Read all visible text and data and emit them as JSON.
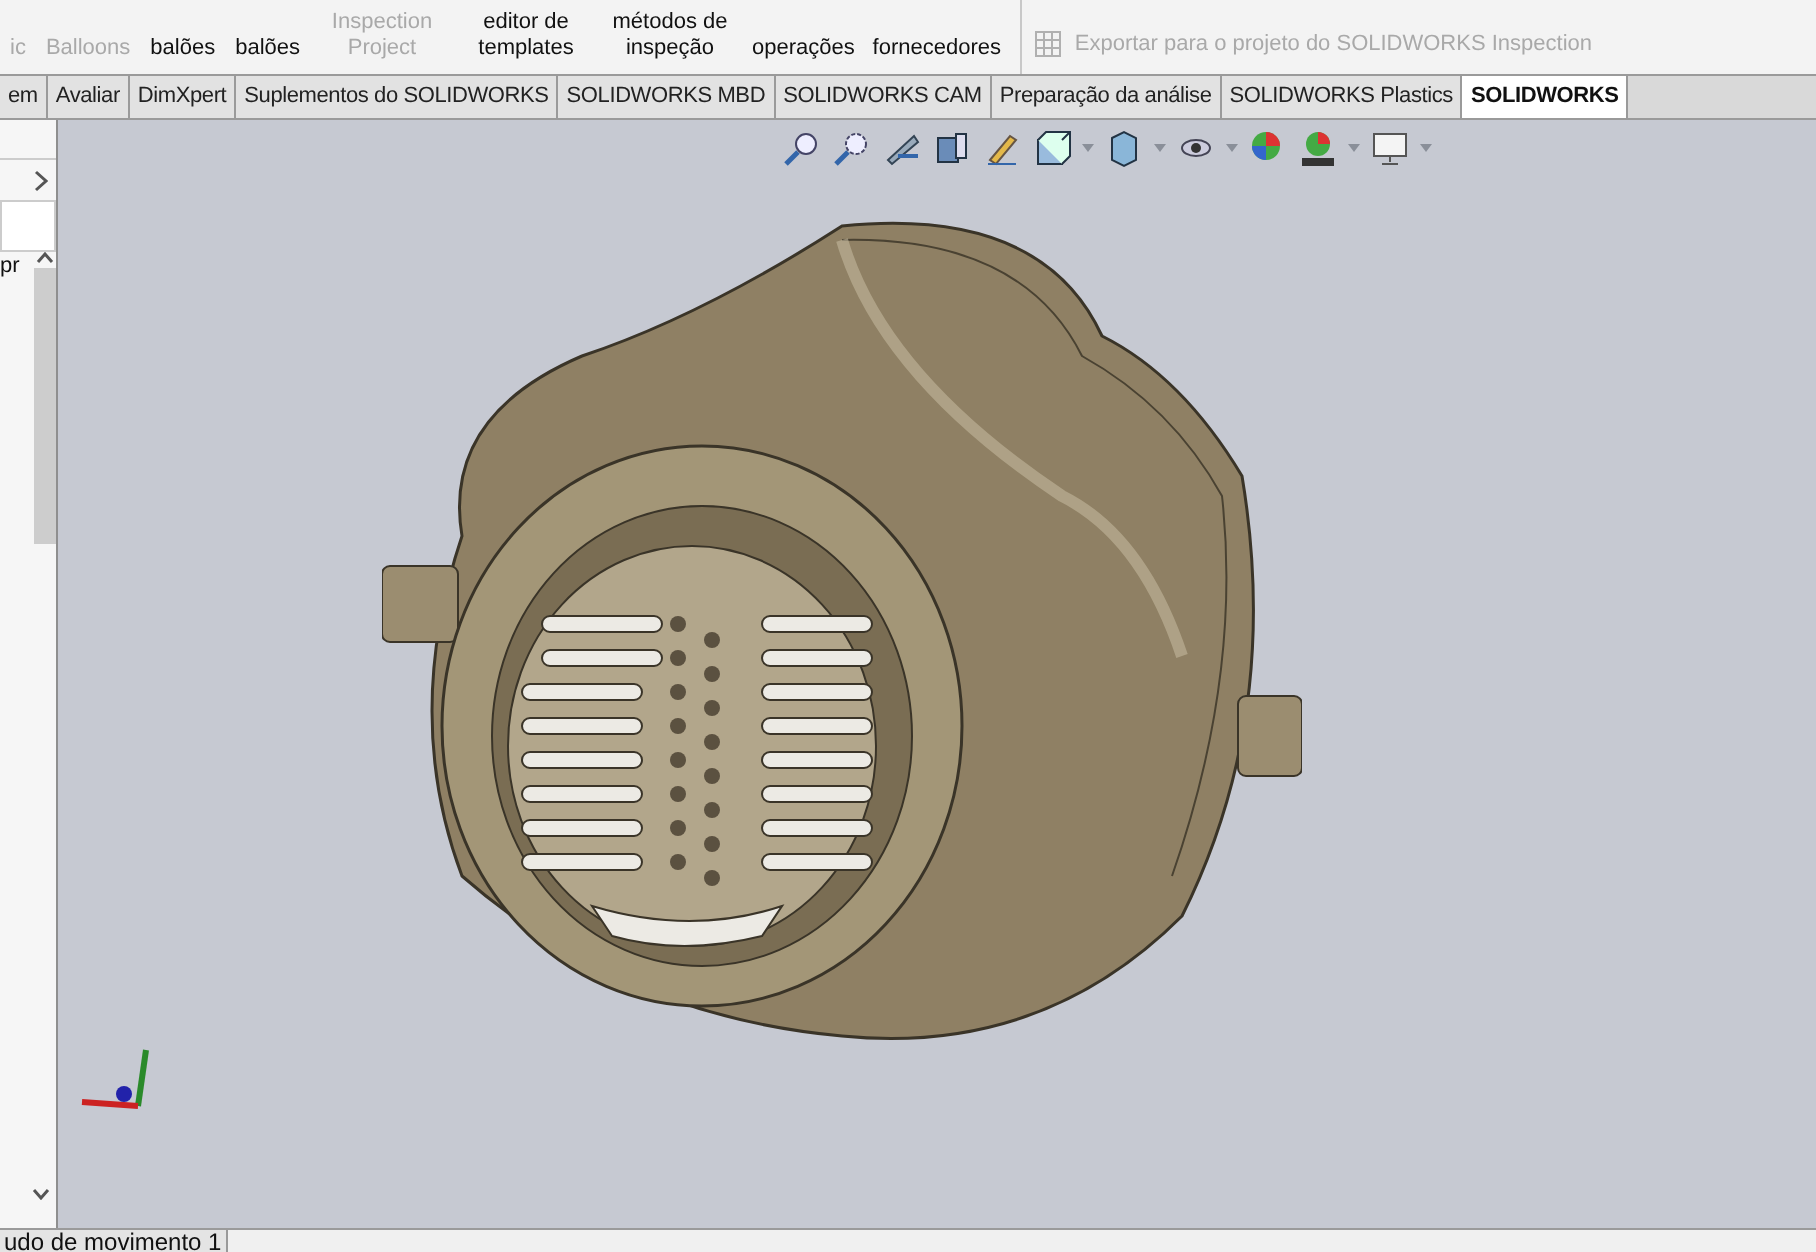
{
  "ribbon": {
    "items": [
      {
        "label": "ic",
        "disabled": true
      },
      {
        "label": "Balloons",
        "disabled": true
      },
      {
        "label": "balões",
        "disabled": false
      },
      {
        "label": "balões",
        "disabled": false
      },
      {
        "label": "Inspection Project",
        "disabled": true
      },
      {
        "label": "editor de templates",
        "disabled": false
      },
      {
        "label": "métodos de inspeção",
        "disabled": false
      },
      {
        "label": "operações",
        "disabled": false
      },
      {
        "label": "fornecedores",
        "disabled": false
      }
    ],
    "export_action": {
      "label": "Exportar para o projeto do SOLIDWORKS Inspection",
      "disabled": true
    }
  },
  "tabs": [
    {
      "label": "em",
      "selected": false
    },
    {
      "label": "Avaliar",
      "selected": false
    },
    {
      "label": "DimXpert",
      "selected": false
    },
    {
      "label": "Suplementos do SOLIDWORKS",
      "selected": false
    },
    {
      "label": "SOLIDWORKS MBD",
      "selected": false
    },
    {
      "label": "SOLIDWORKS CAM",
      "selected": false
    },
    {
      "label": "Preparação da análise",
      "selected": false
    },
    {
      "label": "SOLIDWORKS Plastics",
      "selected": false
    },
    {
      "label": "SOLIDWORKS",
      "selected": true
    }
  ],
  "left_panel": {
    "tree_text": "pr"
  },
  "bottom_tabs": [
    {
      "label": "udo de movimento 1",
      "selected": true
    }
  ]
}
